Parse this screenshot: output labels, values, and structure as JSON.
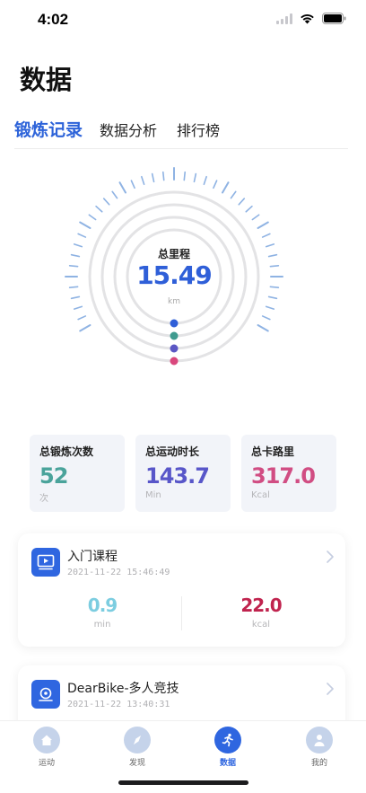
{
  "status_bar": {
    "time": "4:02"
  },
  "page_title": "数据",
  "tabs": [
    {
      "label": "锻炼记录",
      "active": true
    },
    {
      "label": "数据分析",
      "active": false
    },
    {
      "label": "排行榜",
      "active": false
    }
  ],
  "gauge": {
    "label": "总里程",
    "value": "15.49",
    "unit": "km",
    "dot_colors": [
      "#2f5fd8",
      "#3f9b8f",
      "#5b57c4",
      "#d9477d"
    ]
  },
  "stats": [
    {
      "label": "总锻炼次数",
      "value": "52",
      "unit": "次",
      "color": "#4aa39b"
    },
    {
      "label": "总运动时长",
      "value": "143.7",
      "unit": "Min",
      "color": "#5856c9"
    },
    {
      "label": "总卡路里",
      "value": "317.0",
      "unit": "Kcal",
      "color": "#d14d83"
    }
  ],
  "sessions": [
    {
      "title": "入门课程",
      "date": "2021-11-22 15:46:49",
      "icon": "video-icon",
      "metrics": [
        {
          "value": "0.9",
          "unit": "min",
          "color": "#7ccde0"
        },
        {
          "value": "22.0",
          "unit": "kcal",
          "color": "#c0234e"
        }
      ]
    },
    {
      "title": "DearBike-多人竞技",
      "date": "2021-11-22 13:40:31",
      "icon": "bike-icon"
    }
  ],
  "tabbar": [
    {
      "label": "运动",
      "icon": "home-icon",
      "active": false
    },
    {
      "label": "发现",
      "icon": "compass-icon",
      "active": false
    },
    {
      "label": "数据",
      "icon": "runner-icon",
      "active": true
    },
    {
      "label": "我的",
      "icon": "user-icon",
      "active": false
    }
  ]
}
